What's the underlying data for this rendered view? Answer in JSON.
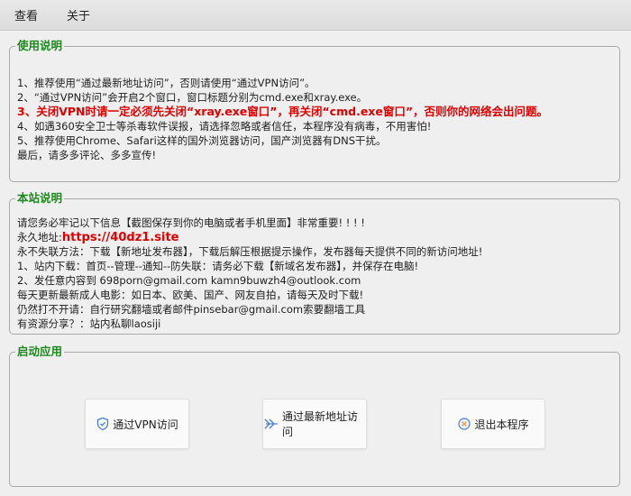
{
  "menu": {
    "items": [
      "查看",
      "关于"
    ]
  },
  "usage": {
    "title": "使用说明",
    "lines": [
      "1、推荐使用“通过最新地址访问”，否则请使用“通过VPN访问”。",
      "2、“通过VPN访问”会开启2个窗口，窗口标题分别为cmd.exe和xray.exe。",
      "3、关闭VPN时请一定必须先关闭“xray.exe窗口”，再关闭“cmd.exe窗口”，否则你的网络会出问题。",
      "4、如遇360安全卫士等杀毒软件误报，请选择忽略或者信任，本程序没有病毒，不用害怕!",
      "5、推荐使用Chrome、Safari这样的国外浏览器访问，国产浏览器有DNS干扰。",
      "最后，请多多评论、多多宣传!"
    ]
  },
  "site": {
    "title": "本站说明",
    "line1": "请您务必牢记以下信息【截图保存到你的电脑或者手机里面】非常重要! ! ! !",
    "permanent_label": "永久地址:",
    "permanent_url": "https://40dz1.site",
    "lines": [
      "永不失联方法：下载【新地址发布器】，下载后解压根据提示操作，发布器每天提供不同的新访问地址!",
      "1、站内下载：首页--管理--通知--防失联：请务必下载【新域名发布器】，并保存在电脑!",
      "2、发任意内容到 698porn@gmail.com kamn9buwzh4@outlook.com",
      "每天更新最新成人电影：如日本、欧美、国产、网友自拍，请每天及时下载!",
      "仍然打不开请：自行研究翻墙或者邮件pinsebar@gmail.com索要翻墙工具",
      "有资源分享？：站内私聊laosiji"
    ]
  },
  "launch": {
    "title": "启动应用",
    "buttons": [
      {
        "label": "通过VPN访问",
        "icon": "shield-icon"
      },
      {
        "label": "通过最新地址访问",
        "icon": "double-arrow-icon"
      },
      {
        "label": "退出本程序",
        "icon": "close-circle-icon"
      }
    ]
  },
  "colors": {
    "group_title": "#1d8a1d",
    "warning": "#e00000",
    "icon_blue": "#4a7fd6"
  }
}
